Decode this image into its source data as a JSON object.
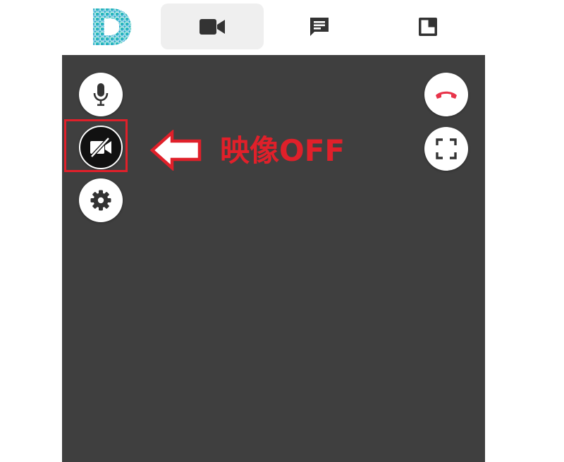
{
  "topbar": {
    "logo_icon": "letter-d-mosaic-logo",
    "tabs": [
      {
        "icon": "video-camera-icon",
        "active": true
      },
      {
        "icon": "chat-icon",
        "active": false
      },
      {
        "icon": "layout-panel-icon",
        "active": false
      }
    ]
  },
  "controls": {
    "left": [
      {
        "icon": "microphone-icon"
      },
      {
        "icon": "video-off-icon",
        "state": "off"
      },
      {
        "icon": "gear-icon"
      }
    ],
    "right": [
      {
        "icon": "hang-up-icon",
        "color": "#e8344a"
      },
      {
        "icon": "fullscreen-icon"
      }
    ]
  },
  "annotation": {
    "text": "映像OFF",
    "color": "#e0202a",
    "arrow_icon": "left-arrow-icon"
  },
  "colors": {
    "stage_bg": "#3f3f3f",
    "logo_gradient": [
      "#2bc7a5",
      "#2a9ee0"
    ]
  }
}
